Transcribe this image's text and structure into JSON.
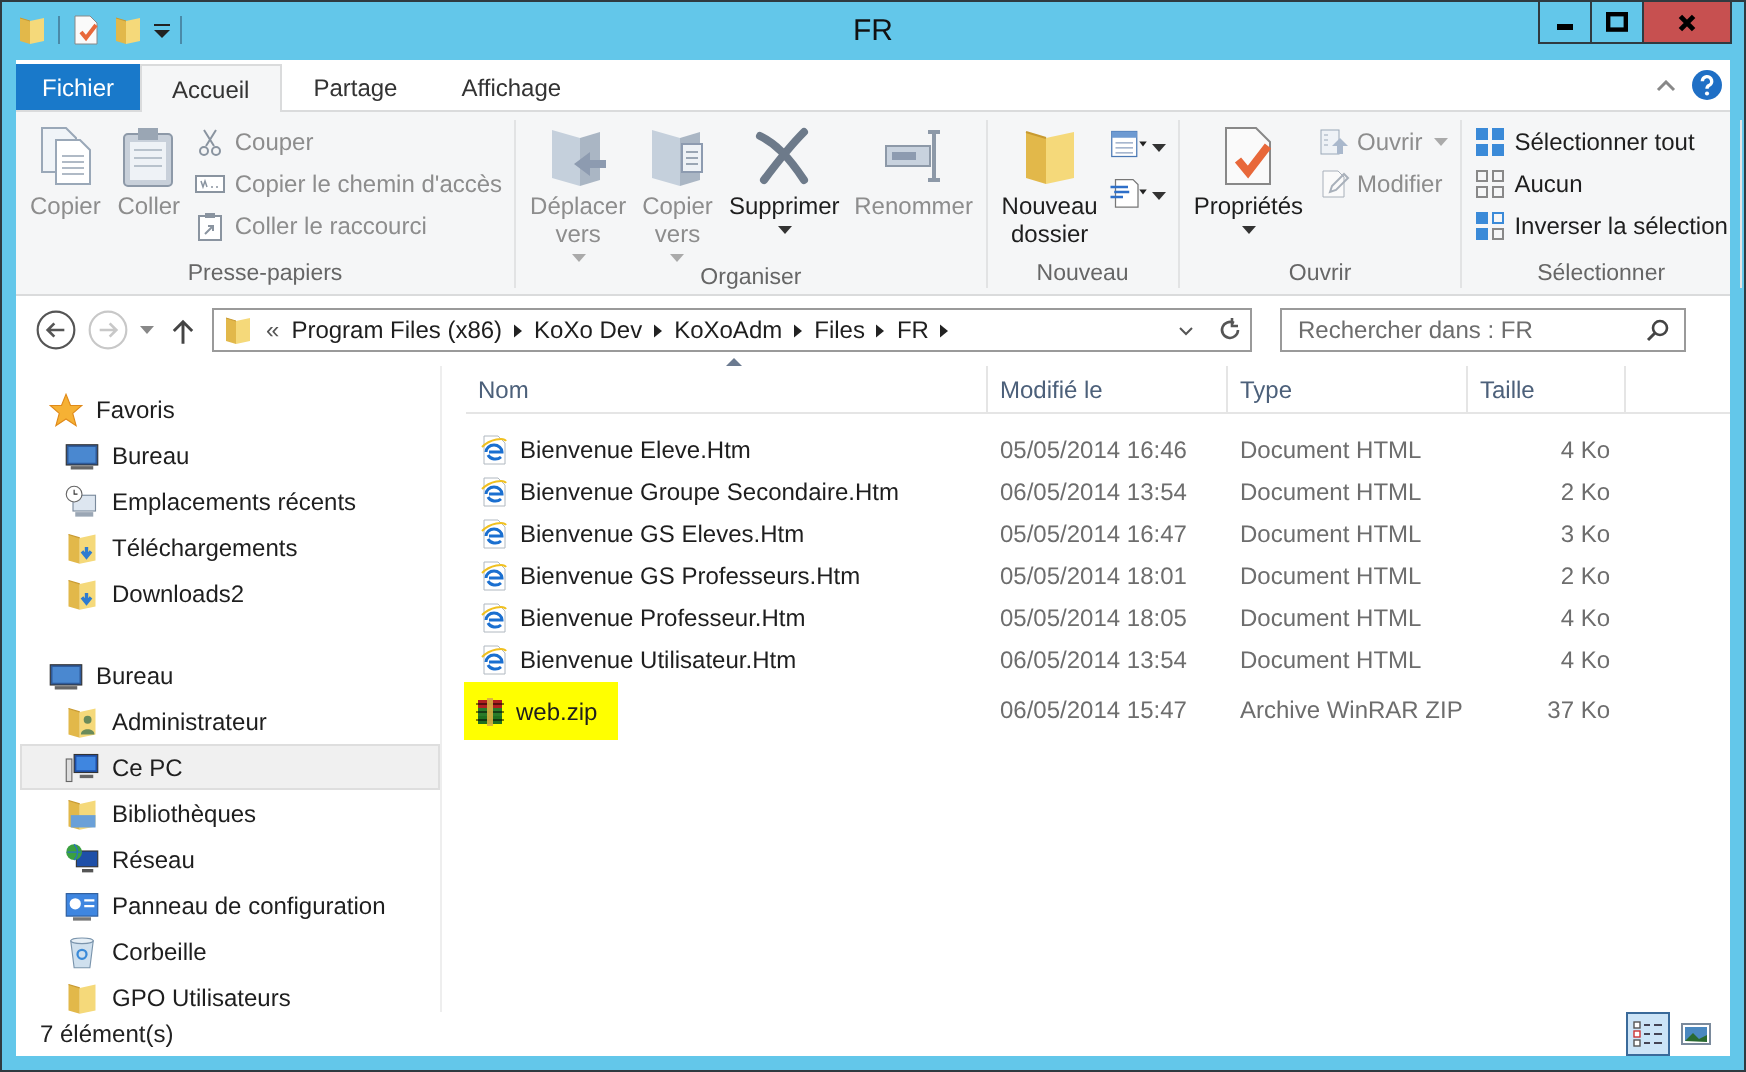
{
  "window": {
    "title": "FR"
  },
  "tabs": [
    {
      "label": "Fichier",
      "kind": "file",
      "selected": false
    },
    {
      "label": "Accueil",
      "kind": "tab",
      "selected": true
    },
    {
      "label": "Partage",
      "kind": "tab",
      "selected": false
    },
    {
      "label": "Affichage",
      "kind": "tab",
      "selected": false
    }
  ],
  "ribbon": [
    {
      "label": "Presse-papiers",
      "items": [
        {
          "kind": "large",
          "label": "Copier",
          "disabled": true,
          "dropdown": false
        },
        {
          "kind": "large",
          "label": "Coller",
          "disabled": true,
          "dropdown": false
        },
        {
          "kind": "small",
          "label": "Couper",
          "disabled": true,
          "dropdown": false
        },
        {
          "kind": "small",
          "label": "Copier le chemin d'accès",
          "disabled": true,
          "dropdown": false
        },
        {
          "kind": "small",
          "label": "Coller le raccourci",
          "disabled": true,
          "dropdown": false
        }
      ]
    },
    {
      "label": "Organiser",
      "items": [
        {
          "kind": "large",
          "label": "Déplacer vers",
          "disabled": true,
          "dropdown": true
        },
        {
          "kind": "large",
          "label": "Copier vers",
          "disabled": true,
          "dropdown": true
        },
        {
          "kind": "large",
          "label": "Supprimer",
          "disabled": false,
          "dropdown": true
        },
        {
          "kind": "large",
          "label": "Renommer",
          "disabled": true,
          "dropdown": false
        }
      ]
    },
    {
      "label": "Nouveau",
      "items": [
        {
          "kind": "large",
          "label": "Nouveau dossier",
          "disabled": false,
          "dropdown": false
        },
        {
          "kind": "icon",
          "disabled": false,
          "dropdown": true
        },
        {
          "kind": "icon",
          "disabled": false,
          "dropdown": true
        }
      ]
    },
    {
      "label": "Ouvrir",
      "items": [
        {
          "kind": "large",
          "label": "Propriétés",
          "disabled": false,
          "dropdown": true
        },
        {
          "kind": "small",
          "label": "Ouvrir",
          "disabled": true,
          "dropdown": true
        },
        {
          "kind": "small",
          "label": "Modifier",
          "disabled": true,
          "dropdown": false
        }
      ]
    },
    {
      "label": "Sélectionner",
      "items": [
        {
          "kind": "small",
          "label": "Sélectionner tout",
          "disabled": false,
          "dropdown": false
        },
        {
          "kind": "small",
          "label": "Aucun",
          "disabled": false,
          "dropdown": false
        },
        {
          "kind": "small",
          "label": "Inverser la sélection",
          "disabled": false,
          "dropdown": false
        }
      ]
    }
  ],
  "navigation": {
    "back_disabled": false,
    "forward_disabled": true
  },
  "address": {
    "prefix": "«",
    "segments": [
      "Program Files (x86)",
      "KoXo Dev",
      "KoXoAdm",
      "Files",
      "FR"
    ]
  },
  "search": {
    "placeholder": "Rechercher dans : FR"
  },
  "sidebar": [
    {
      "label": "Favoris",
      "selected": false,
      "children": [
        {
          "label": "Bureau",
          "selected": false
        },
        {
          "label": "Emplacements récents",
          "selected": false
        },
        {
          "label": "Téléchargements",
          "selected": false
        },
        {
          "label": "Downloads2",
          "selected": false
        }
      ]
    },
    {
      "label": "Bureau",
      "selected": false,
      "children": [
        {
          "label": "Administrateur",
          "selected": false
        },
        {
          "label": "Ce PC",
          "selected": true
        },
        {
          "label": "Bibliothèques",
          "selected": false
        },
        {
          "label": "Réseau",
          "selected": false
        },
        {
          "label": "Panneau de configuration",
          "selected": false
        },
        {
          "label": "Corbeille",
          "selected": false
        },
        {
          "label": "GPO Utilisateurs",
          "selected": false
        }
      ]
    }
  ],
  "table": {
    "columns": [
      {
        "label": "Nom",
        "sorted": true
      },
      {
        "label": "Modifié le",
        "sorted": false
      },
      {
        "label": "Type",
        "sorted": false
      },
      {
        "label": "Taille",
        "sorted": false
      }
    ],
    "rows": [
      {
        "kind": "html",
        "name": "Bienvenue Eleve.Htm",
        "modified": "05/05/2014 16:46",
        "type": "Document HTML",
        "size": "4 Ko",
        "highlighted": false
      },
      {
        "kind": "html",
        "name": "Bienvenue Groupe Secondaire.Htm",
        "modified": "06/05/2014 13:54",
        "type": "Document HTML",
        "size": "2 Ko",
        "highlighted": false
      },
      {
        "kind": "html",
        "name": "Bienvenue GS Eleves.Htm",
        "modified": "05/05/2014 16:47",
        "type": "Document HTML",
        "size": "3 Ko",
        "highlighted": false
      },
      {
        "kind": "html",
        "name": "Bienvenue GS Professeurs.Htm",
        "modified": "05/05/2014 18:01",
        "type": "Document HTML",
        "size": "2 Ko",
        "highlighted": false
      },
      {
        "kind": "html",
        "name": "Bienvenue Professeur.Htm",
        "modified": "05/05/2014 18:05",
        "type": "Document HTML",
        "size": "4 Ko",
        "highlighted": false
      },
      {
        "kind": "html",
        "name": "Bienvenue Utilisateur.Htm",
        "modified": "06/05/2014 13:54",
        "type": "Document HTML",
        "size": "4 Ko",
        "highlighted": false
      },
      {
        "kind": "zip",
        "name": "web.zip",
        "modified": "06/05/2014 15:47",
        "type": "Archive WinRAR ZIP",
        "size": "37 Ko",
        "highlighted": true
      }
    ]
  },
  "status_bar": {
    "text": "7 élément(s)",
    "views": [
      {
        "kind": "details",
        "selected": true
      },
      {
        "kind": "large_icons",
        "selected": false
      }
    ]
  }
}
